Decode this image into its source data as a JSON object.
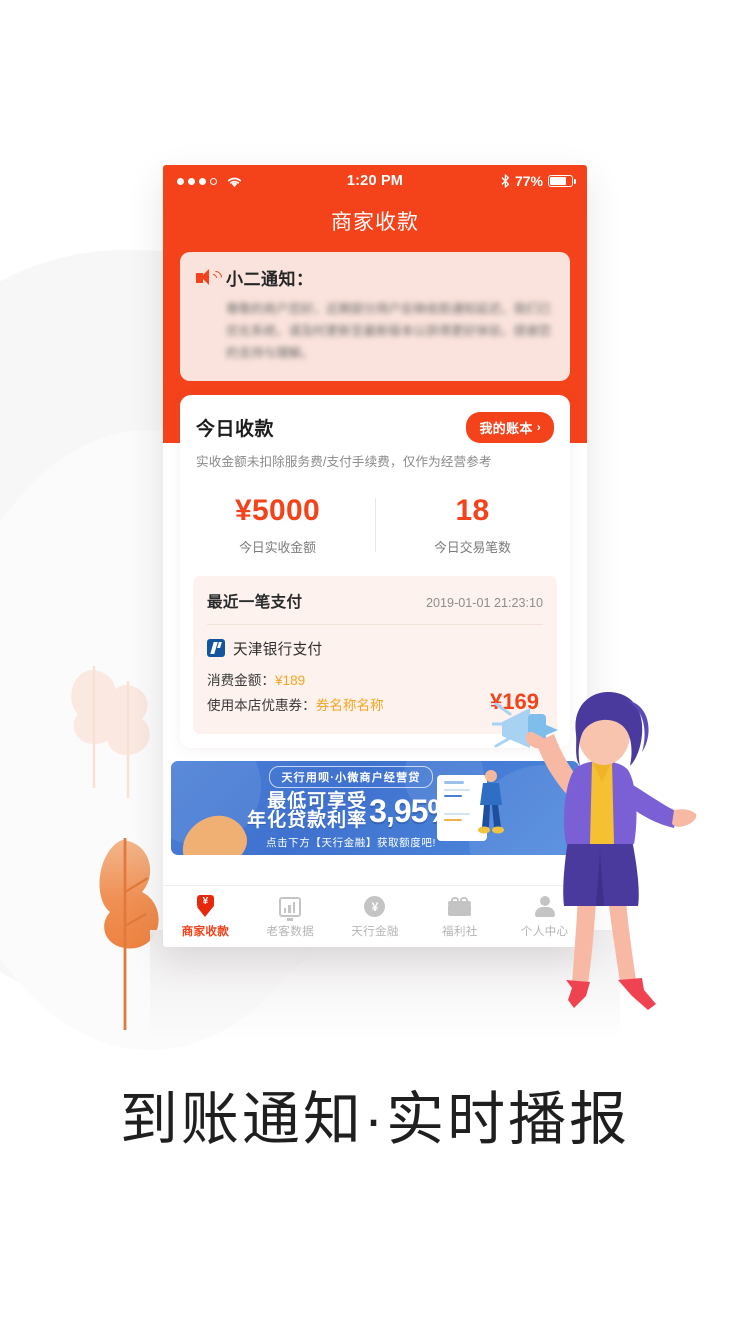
{
  "status_bar": {
    "time": "1:20 PM",
    "battery_percent": "77%",
    "signal_icon": "signal-dots-icon",
    "wifi_icon": "wifi-icon",
    "bluetooth_icon": "bluetooth-icon",
    "battery_icon": "battery-icon"
  },
  "navbar": {
    "title": "商家收款"
  },
  "notice": {
    "icon": "speaker-icon",
    "title": "小二通知：",
    "body": "尊敬的商户您好，近期部分用户反映收款通知延迟，我们已优化系统，请及时更新至最新版本以获得更好体验，感谢您的支持与理解。"
  },
  "today_card": {
    "title": "今日收款",
    "ledger_button": "我的账本",
    "ledger_chevron": "›",
    "subtitle": "实收金额未扣除服务费/支付手续费，仅作为经营参考",
    "stats": [
      {
        "value": "¥5000",
        "label": "今日实收金额"
      },
      {
        "value": "18",
        "label": "今日交易笔数"
      }
    ],
    "recent": {
      "title": "最近一笔支付",
      "datetime": "2019-01-01 21:23:10",
      "bank_logo": "tianjin-bank-logo",
      "method": "天津银行支付",
      "amount_label": "消费金额：",
      "amount_value": "¥189",
      "coupon_label": "使用本店优惠券：",
      "coupon_value": "券名称名称",
      "total": "¥169"
    }
  },
  "banner": {
    "pill": "天行用呗·小微商户经营贷",
    "headline_line1": "最低可享受",
    "headline_line2": "年化贷款利率",
    "rate": "3,95%",
    "footer": "点击下方【天行金融】获取额度吧!"
  },
  "tabbar": {
    "items": [
      {
        "label": "商家收款",
        "icon": "down-arrow-yen-icon",
        "active": true
      },
      {
        "label": "老客数据",
        "icon": "bar-chart-icon",
        "active": false
      },
      {
        "label": "天行金融",
        "icon": "yen-circle-icon",
        "active": false
      },
      {
        "label": "福利社",
        "icon": "gift-icon",
        "active": false
      },
      {
        "label": "个人中心",
        "icon": "person-icon",
        "active": false
      }
    ]
  },
  "caption": "到账通知·实时播报",
  "colors": {
    "brand_orange": "#f4421a",
    "notice_bg": "#fae3dc",
    "recent_bg": "#fdf2ee",
    "banner_blue": "#4a7fd6",
    "accent_yellow": "#f5a623",
    "bank_blue": "#1256a0"
  }
}
